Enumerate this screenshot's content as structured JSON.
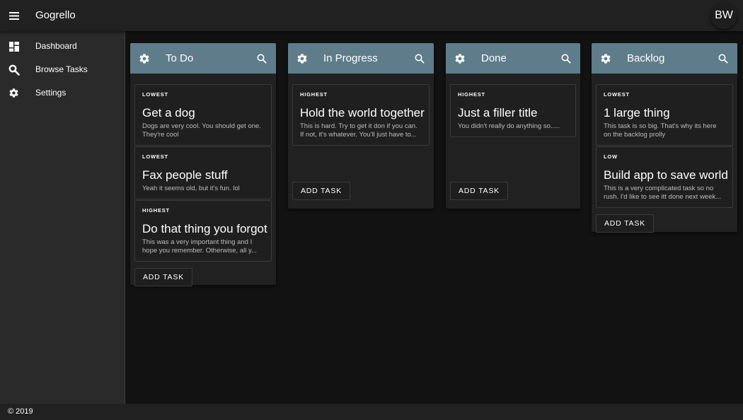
{
  "app": {
    "title": "Gogrello",
    "avatar_initials": "BW"
  },
  "sidebar": {
    "items": [
      {
        "label": "Dashboard",
        "icon": "dashboard-icon"
      },
      {
        "label": "Browse Tasks",
        "icon": "search-icon"
      },
      {
        "label": "Settings",
        "icon": "gear-icon"
      }
    ]
  },
  "colors": {
    "header_accent": "#5f7c8a",
    "surface": "#212121",
    "background": "#121212"
  },
  "columns": [
    {
      "title": "To Do",
      "add_label": "ADD TASK",
      "cards": [
        {
          "priority": "LOWEST",
          "title": "Get a dog",
          "desc": "Dogs are very cool. You should get one. They're cool"
        },
        {
          "priority": "LOWEST",
          "title": "Fax people stuff",
          "desc": "Yeah it seems old, but it's fun. lol"
        },
        {
          "priority": "HIGHEST",
          "title": "Do that thing you forgot",
          "desc": "This was a very important thing and I hope you remember. Otherwise, all y..."
        }
      ]
    },
    {
      "title": "In Progress",
      "add_label": "ADD TASK",
      "cards": [
        {
          "priority": "HIGHEST",
          "title": "Hold the world together",
          "desc": "This is hard. Try to get it don if you can. If not, it's whatever. You'll just have to..."
        }
      ]
    },
    {
      "title": "Done",
      "add_label": "ADD TASK",
      "cards": [
        {
          "priority": "HIGHEST",
          "title": "Just a filler title",
          "desc": "You didn't really do anything so....."
        }
      ]
    },
    {
      "title": "Backlog",
      "add_label": "ADD TASK",
      "cards": [
        {
          "priority": "LOWEST",
          "title": "1 large thing",
          "desc": "This task is so big. That's why its here on the backlog prolly"
        },
        {
          "priority": "LOW",
          "title": "Build app to save world",
          "desc": "This is a very complicated task so no rush. I'd like to see itt done next week..."
        }
      ]
    }
  ],
  "footer": {
    "text": "© 2019"
  }
}
